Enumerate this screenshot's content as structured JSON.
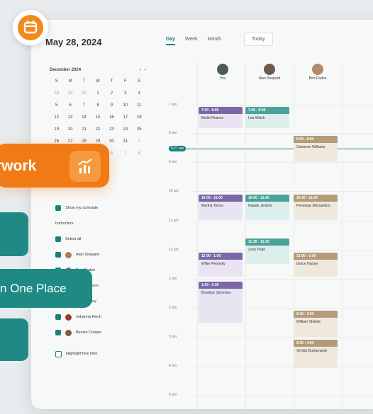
{
  "app_icon": "calendar-icon",
  "header": {
    "date_title": "May 28, 2024",
    "views": [
      "Day",
      "Week",
      "Month"
    ],
    "active_view": "Day",
    "today_label": "Today"
  },
  "mini_calendar": {
    "month_label": "December 2024",
    "weekdays": [
      "S",
      "M",
      "T",
      "W",
      "T",
      "F",
      "S"
    ],
    "rows": [
      [
        "28",
        "29",
        "30",
        "1",
        "2",
        "3",
        "4"
      ],
      [
        "5",
        "6",
        "7",
        "8",
        "9",
        "10",
        "11"
      ],
      [
        "12",
        "13",
        "14",
        "15",
        "16",
        "17",
        "18"
      ],
      [
        "19",
        "20",
        "21",
        "22",
        "23",
        "24",
        "25"
      ],
      [
        "26",
        "27",
        "28",
        "29",
        "30",
        "31",
        "1"
      ],
      [
        "2",
        "3",
        "4",
        "5",
        "6",
        "7",
        "8"
      ]
    ]
  },
  "sidebar": {
    "show_schedule_label": "Show my schedule",
    "instructors_heading": "Instructors",
    "select_all_label": "Select all",
    "instructors": [
      "Alan Shepard",
      "Ben Paden",
      "Eve Johnson",
      "Jon Bradley",
      "Johanna Finch",
      "Bessie Cooper"
    ],
    "highlight_label": "Highlight free time"
  },
  "columns": [
    {
      "name": "You"
    },
    {
      "name": "Alan Shepard"
    },
    {
      "name": "Ben Paden"
    }
  ],
  "hours": [
    "7 am",
    "8 am",
    "9 am",
    "10 am",
    "11 am",
    "12 am",
    "1 am",
    "2 am",
    "3 am",
    "4 am",
    "5 am",
    "6 am"
  ],
  "now_label": "8:27 am",
  "events": [
    {
      "time": "7:00 - 8:00",
      "name": "Bettie Reaves"
    },
    {
      "time": "7:00 - 8:00",
      "name": "Lea Welch"
    },
    {
      "time": "8:00 - 9:00",
      "name": "Cameron Williams"
    },
    {
      "time": "10:00 - 11:00",
      "name": "Martha Torres"
    },
    {
      "time": "10:00 - 11:00",
      "name": "Natalie Jenkins"
    },
    {
      "time": "10:00 - 11:00",
      "name": "Penelope Michaelson"
    },
    {
      "time": "11:30 - 12:30",
      "name": "Zoey Patel"
    },
    {
      "time": "12:00 - 1:00",
      "name": "Willie Pelonsky"
    },
    {
      "time": "12:00 - 1:00",
      "name": "Grace Harper"
    },
    {
      "time": "1:00 - 2:30",
      "name": "Brooklyn Simmons"
    },
    {
      "time": "2:00 - 3:00",
      "name": "William Shields"
    },
    {
      "time": "3:00 - 4:00",
      "name": "Verlida Bustamante"
    }
  ],
  "overlays": {
    "orange_text": "rwork",
    "orange_icon": "chart-icon",
    "teal_text": "n One Place"
  },
  "colors": {
    "accent": "#1a7f7a",
    "orange": "#f07a16",
    "purple": "#7a67a8",
    "teal_event": "#4aa39a",
    "tan_event": "#b59b7a"
  }
}
